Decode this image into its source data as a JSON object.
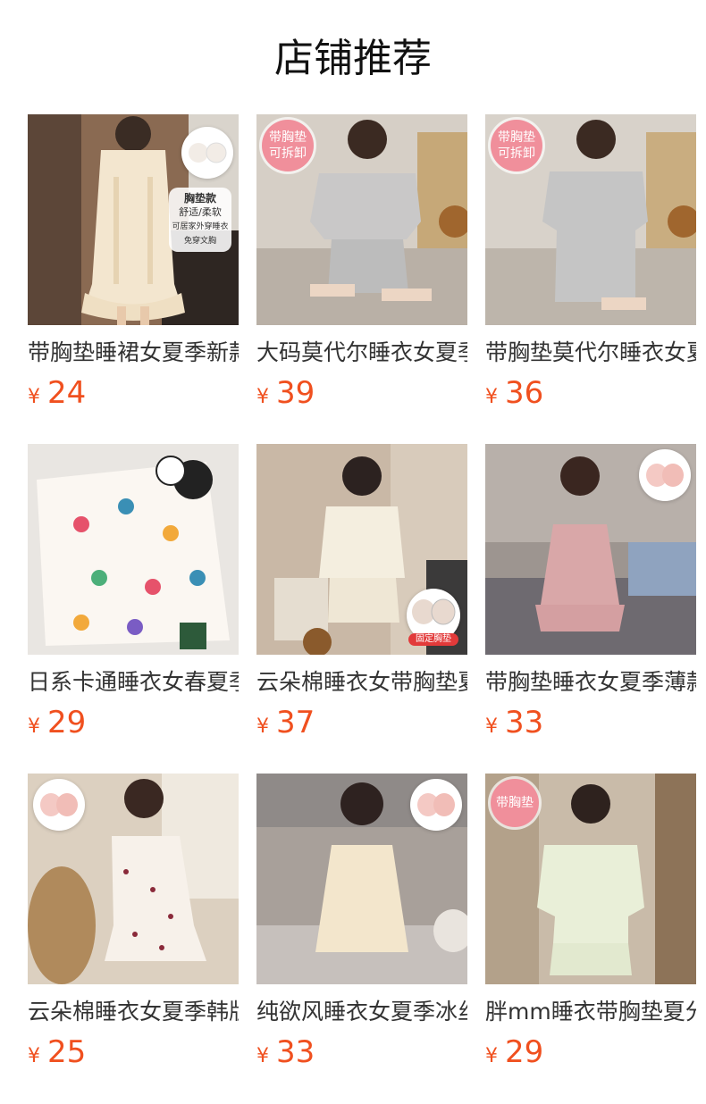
{
  "page": {
    "title": "店铺推荐"
  },
  "currency_symbol": "¥",
  "accent_color": "#f0501f",
  "products": [
    {
      "name": "带胸垫睡裙女夏季新款",
      "price": "24",
      "badge": "",
      "tag_lines": [
        "胸垫款",
        "舒适/柔软",
        "可居家外穿睡衣",
        "免穿文胸"
      ],
      "fixed_pad_label": ""
    },
    {
      "name": "大码莫代尔睡衣女夏季",
      "price": "39",
      "badge": "带胸垫\n可拆卸",
      "tag_lines": [],
      "fixed_pad_label": ""
    },
    {
      "name": "带胸垫莫代尔睡衣女夏",
      "price": "36",
      "badge": "带胸垫\n可拆卸",
      "tag_lines": [],
      "fixed_pad_label": ""
    },
    {
      "name": "日系卡通睡衣女春夏季",
      "price": "29",
      "badge": "",
      "tag_lines": [],
      "fixed_pad_label": ""
    },
    {
      "name": "云朵棉睡衣女带胸垫夏",
      "price": "37",
      "badge": "",
      "tag_lines": [],
      "fixed_pad_label": "固定胸垫"
    },
    {
      "name": "带胸垫睡衣女夏季薄款",
      "price": "33",
      "badge": "",
      "tag_lines": [],
      "fixed_pad_label": ""
    },
    {
      "name": "云朵棉睡衣女夏季韩版",
      "price": "25",
      "badge": "",
      "tag_lines": [],
      "fixed_pad_label": ""
    },
    {
      "name": "纯欲风睡衣女夏季冰丝",
      "price": "33",
      "badge": "",
      "tag_lines": [],
      "fixed_pad_label": ""
    },
    {
      "name": "胖mm睡衣带胸垫夏分体",
      "price": "29",
      "badge": "带胸垫",
      "tag_lines": [],
      "fixed_pad_label": ""
    }
  ]
}
